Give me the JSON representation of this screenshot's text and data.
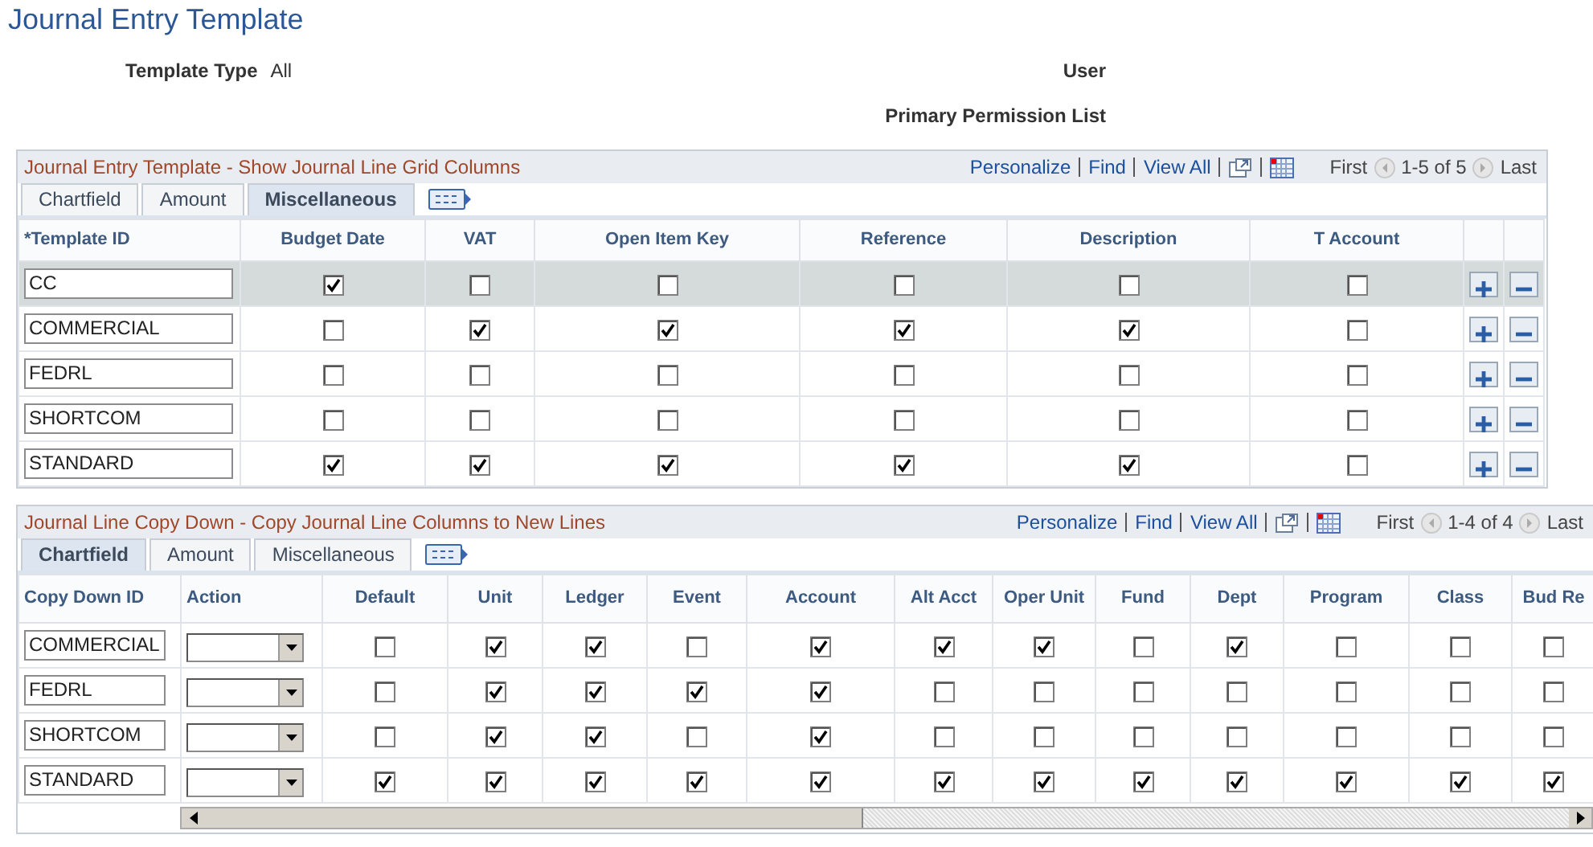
{
  "page_title": "Journal Entry Template",
  "fields": [
    {
      "label": "Template Type",
      "value": "All"
    },
    {
      "label": "User"
    },
    {
      "label": "Primary Permission List"
    }
  ],
  "grids": [
    {
      "title": "Journal Entry Template - Show Journal Line Grid Columns",
      "links": [
        "Personalize",
        "Find",
        "View All"
      ],
      "first": "First",
      "range": "1-5 of 5",
      "last": "Last",
      "tabs": [
        {
          "label": "Chartfield",
          "selected": false
        },
        {
          "label": "Amount",
          "selected": false
        },
        {
          "label": "Miscellaneous",
          "selected": true
        }
      ],
      "columns": [
        {
          "label": "*Template ID",
          "kind": "id"
        },
        {
          "label": "Budget Date",
          "kind": "check"
        },
        {
          "label": "VAT",
          "kind": "check"
        },
        {
          "label": "Open Item Key",
          "kind": "check"
        },
        {
          "label": "Reference",
          "kind": "check"
        },
        {
          "label": "Description",
          "kind": "check"
        },
        {
          "label": "T Account",
          "kind": "check"
        }
      ],
      "row_buttons": true,
      "horizontal_scroll": false,
      "rows": [
        {
          "id": "CC",
          "selected": true,
          "checks": [
            true,
            false,
            false,
            false,
            false,
            false
          ]
        },
        {
          "id": "COMMERCIAL",
          "selected": false,
          "checks": [
            false,
            true,
            true,
            true,
            true,
            false
          ]
        },
        {
          "id": "FEDRL",
          "selected": false,
          "checks": [
            false,
            false,
            false,
            false,
            false,
            false
          ]
        },
        {
          "id": "SHORTCOM",
          "selected": false,
          "checks": [
            false,
            false,
            false,
            false,
            false,
            false
          ]
        },
        {
          "id": "STANDARD",
          "selected": false,
          "checks": [
            true,
            true,
            true,
            true,
            true,
            false
          ]
        }
      ]
    },
    {
      "title": "Journal Line Copy Down - Copy Journal Line Columns to New Lines",
      "links": [
        "Personalize",
        "Find",
        "View All"
      ],
      "first": "First",
      "range": "1-4 of 4",
      "last": "Last",
      "tabs": [
        {
          "label": "Chartfield",
          "selected": true
        },
        {
          "label": "Amount",
          "selected": false
        },
        {
          "label": "Miscellaneous",
          "selected": false
        }
      ],
      "columns": [
        {
          "label": "Copy Down ID",
          "kind": "id"
        },
        {
          "label": "Action",
          "kind": "dropdown"
        },
        {
          "label": "Default",
          "kind": "check"
        },
        {
          "label": "Unit",
          "kind": "check"
        },
        {
          "label": "Ledger",
          "kind": "check"
        },
        {
          "label": "Event",
          "kind": "check"
        },
        {
          "label": "Account",
          "kind": "check"
        },
        {
          "label": "Alt Acct",
          "kind": "check"
        },
        {
          "label": "Oper Unit",
          "kind": "check"
        },
        {
          "label": "Fund",
          "kind": "check"
        },
        {
          "label": "Dept",
          "kind": "check"
        },
        {
          "label": "Program",
          "kind": "check"
        },
        {
          "label": "Class",
          "kind": "check"
        },
        {
          "label": "Bud Re",
          "kind": "check"
        }
      ],
      "row_buttons": false,
      "horizontal_scroll": true,
      "rows": [
        {
          "id": "COMMERCIAL",
          "checks": [
            false,
            true,
            true,
            false,
            true,
            true,
            true,
            false,
            true,
            false,
            false,
            false
          ]
        },
        {
          "id": "FEDRL",
          "checks": [
            false,
            true,
            true,
            true,
            true,
            false,
            false,
            false,
            false,
            false,
            false,
            false
          ]
        },
        {
          "id": "SHORTCOM",
          "checks": [
            false,
            true,
            true,
            false,
            true,
            false,
            false,
            false,
            false,
            false,
            false,
            false
          ]
        },
        {
          "id": "STANDARD",
          "checks": [
            true,
            true,
            true,
            true,
            true,
            true,
            true,
            true,
            true,
            true,
            true,
            true
          ]
        }
      ]
    }
  ]
}
